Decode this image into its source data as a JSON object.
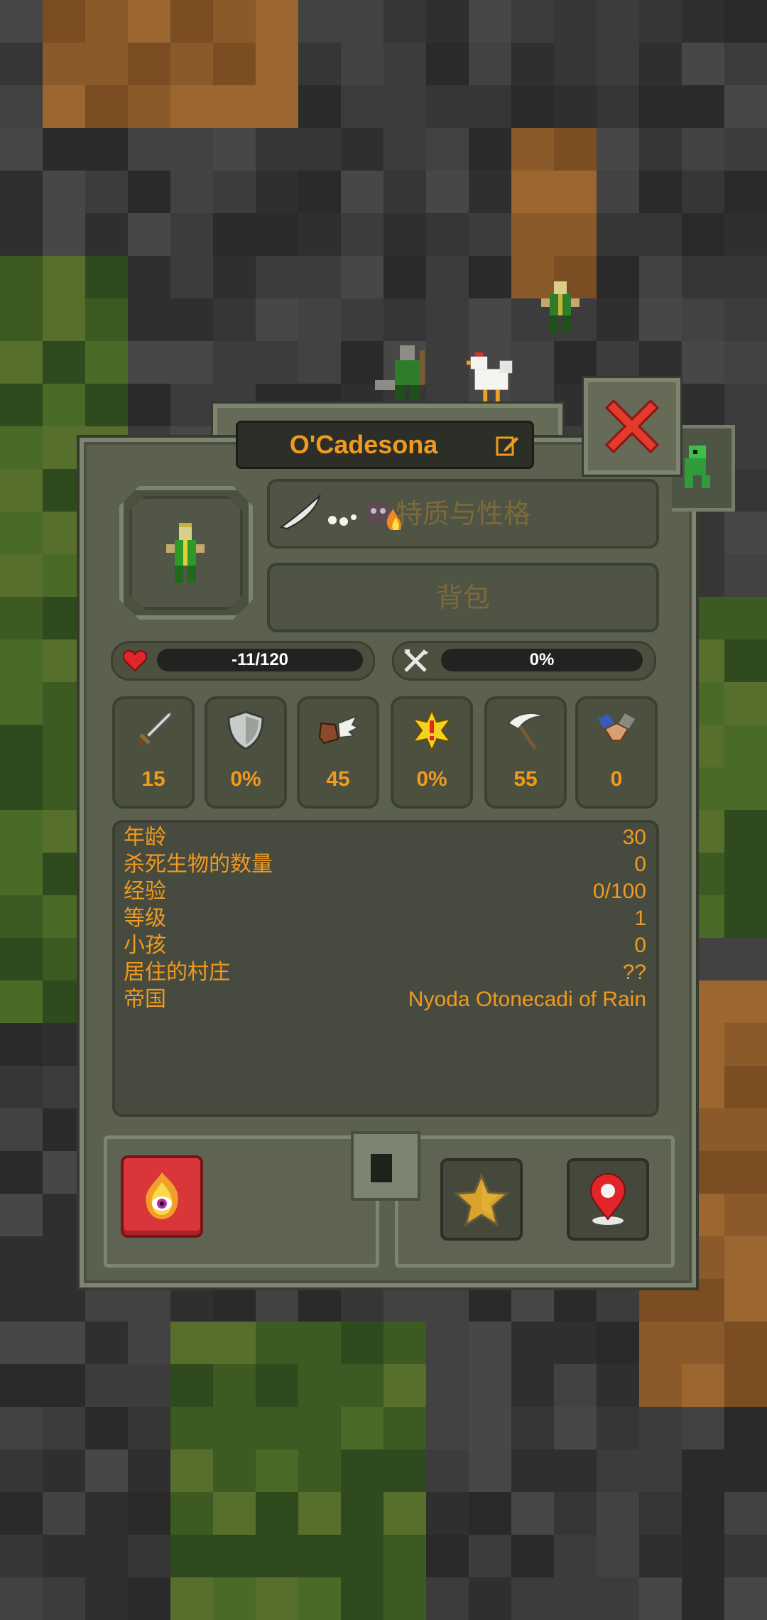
{
  "unit": {
    "name": "O'Cadesona",
    "tabs": {
      "traits_label": "特质与性格",
      "inventory_label": "背包"
    },
    "health": {
      "text": "-11/120",
      "fraction": 0
    },
    "hunger": {
      "text": "0%",
      "fraction": 0
    },
    "stats": [
      {
        "icon": "sword-icon",
        "value": "15"
      },
      {
        "icon": "shield-icon",
        "value": "0%"
      },
      {
        "icon": "winged-boot-icon",
        "value": "45"
      },
      {
        "icon": "critical-star-icon",
        "value": "0%"
      },
      {
        "icon": "scythe-icon",
        "value": "55"
      },
      {
        "icon": "diplomacy-handshake-icon",
        "value": "0"
      }
    ],
    "info": [
      {
        "label": "年龄",
        "value": "30"
      },
      {
        "label": "杀死生物的数量",
        "value": "0"
      },
      {
        "label": "经验",
        "value": "0/100"
      },
      {
        "label": "等级",
        "value": "1"
      },
      {
        "label": "小孩",
        "value": "0"
      },
      {
        "label": "居住的村庄",
        "value": "??"
      },
      {
        "label": "帝国",
        "value": "Nyoda Otonecadi of Rain"
      }
    ]
  },
  "icons": {
    "close": "close-x-icon",
    "edit": "edit-name-icon",
    "heart": "heart-icon",
    "hunger": "fork-knife-icon",
    "traits": [
      "feather-icon",
      "dots-icon",
      "skull-fire-icon"
    ],
    "curse_power": "fire-eye-power-icon",
    "favorite": "star-icon",
    "locate": "location-pin-icon"
  },
  "colors": {
    "accent_text": "#f09a1e",
    "panel": "#5b614e",
    "close_red": "#e23a2c",
    "power_button": "#d9363a"
  }
}
